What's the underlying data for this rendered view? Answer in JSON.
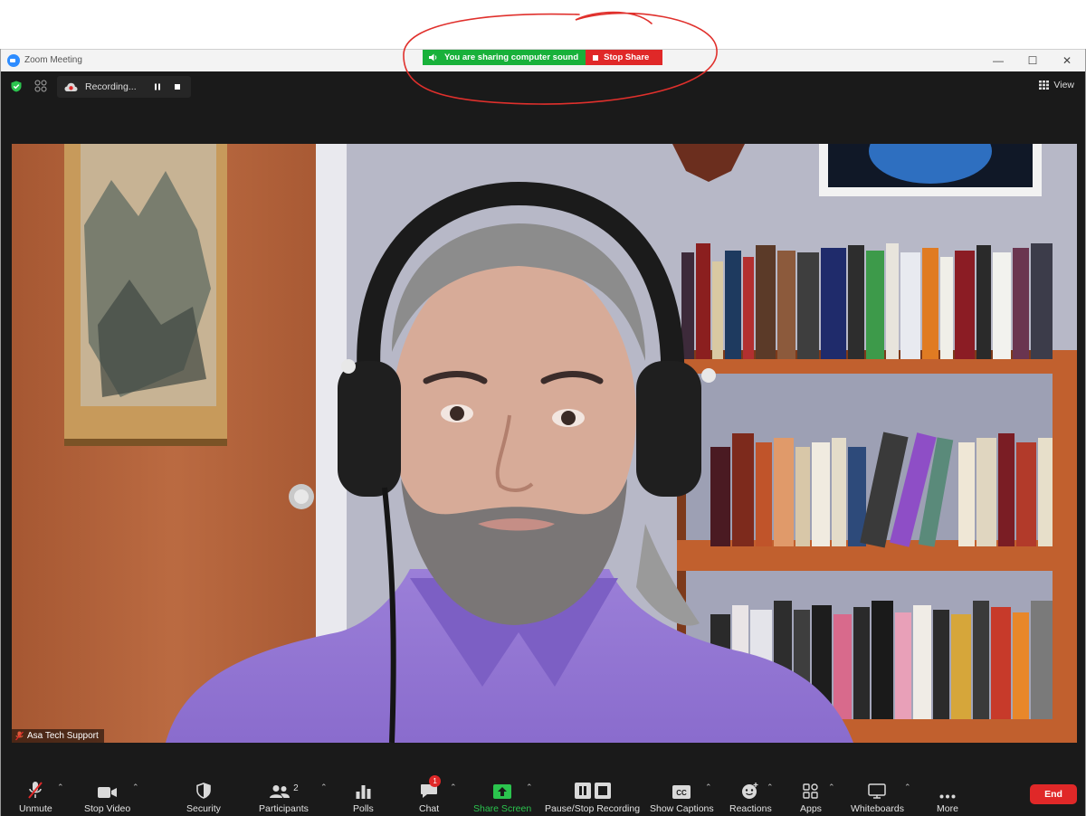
{
  "window": {
    "title": "Zoom Meeting",
    "minimize": "—",
    "maximize": "☐",
    "close": "✕"
  },
  "share_banner": {
    "status": "You are sharing computer sound",
    "stop_label": "Stop Share"
  },
  "meeting_bar": {
    "recording_label": "Recording...",
    "view_label": "View"
  },
  "participant": {
    "name": "Asa Tech Support"
  },
  "toolbar": {
    "unmute": "Unmute",
    "stop_video": "Stop Video",
    "security": "Security",
    "participants": "Participants",
    "participants_count": "2",
    "polls": "Polls",
    "chat": "Chat",
    "chat_badge": "1",
    "share_screen": "Share Screen",
    "pause_stop_recording": "Pause/Stop Recording",
    "show_captions": "Show Captions",
    "reactions": "Reactions",
    "apps": "Apps",
    "whiteboards": "Whiteboards",
    "more": "More",
    "end": "End"
  },
  "colors": {
    "share_green": "#18b13a",
    "stop_red": "#e02828",
    "toolbar_bg": "#1a1a1a",
    "annotation_red": "#e0302c"
  }
}
